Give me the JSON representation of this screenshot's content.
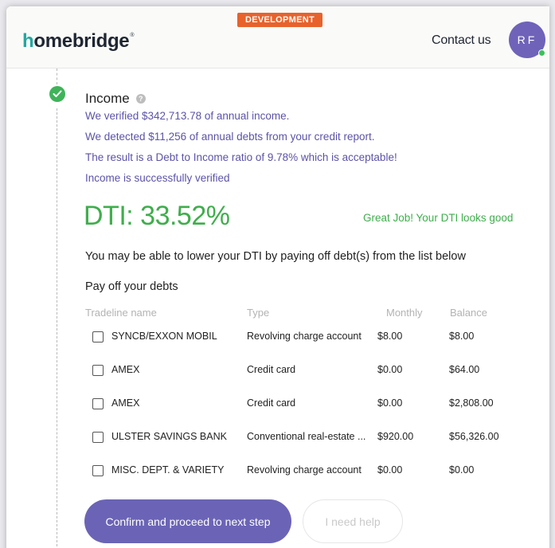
{
  "header": {
    "badge": "DEVELOPMENT",
    "logo_mark": "h",
    "logo_rest": "omebridge",
    "logo_reg": "®",
    "contact": "Contact us",
    "avatar_initials": "RF"
  },
  "income": {
    "title": "Income",
    "info_icon": "?",
    "messages": [
      "We verified $342,713.78 of annual income.",
      "We detected $11,256 of annual debts from your credit report.",
      "The result is a Debt to Income ratio of 9.78% which is acceptable!",
      "Income is successfully verified"
    ],
    "dti": "DTI: 33.52%",
    "dti_status": "Great Job! Your DTI looks good",
    "lower_text": "You may be able to lower your DTI by paying off debt(s) from the list below",
    "payoff_title": "Pay off your debts"
  },
  "table": {
    "headers": [
      "Tradeline name",
      "Type",
      "Monthly",
      "Balance"
    ],
    "rows": [
      {
        "name": "SYNCB/EXXON MOBIL",
        "type": "Revolving charge account",
        "monthly": "$8.00",
        "balance": "$8.00",
        "checked": false
      },
      {
        "name": "AMEX",
        "type": "Credit card",
        "monthly": "$0.00",
        "balance": "$64.00",
        "checked": false
      },
      {
        "name": "AMEX",
        "type": "Credit card",
        "monthly": "$0.00",
        "balance": "$2,808.00",
        "checked": false
      },
      {
        "name": "ULSTER SAVINGS BANK",
        "type": "Conventional real-estate ...",
        "monthly": "$920.00",
        "balance": "$56,326.00",
        "checked": false
      },
      {
        "name": "MISC. DEPT. & VARIETY",
        "type": "Revolving charge account",
        "monthly": "$0.00",
        "balance": "$0.00",
        "checked": false
      }
    ]
  },
  "buttons": {
    "confirm": "Confirm and proceed to next step",
    "help": "I need help"
  },
  "colors": {
    "accent": "#6b64b6",
    "success": "#3fae4c",
    "message": "#5b53a8",
    "badge": "#e8622c",
    "logo_mark": "#24a6a0"
  }
}
